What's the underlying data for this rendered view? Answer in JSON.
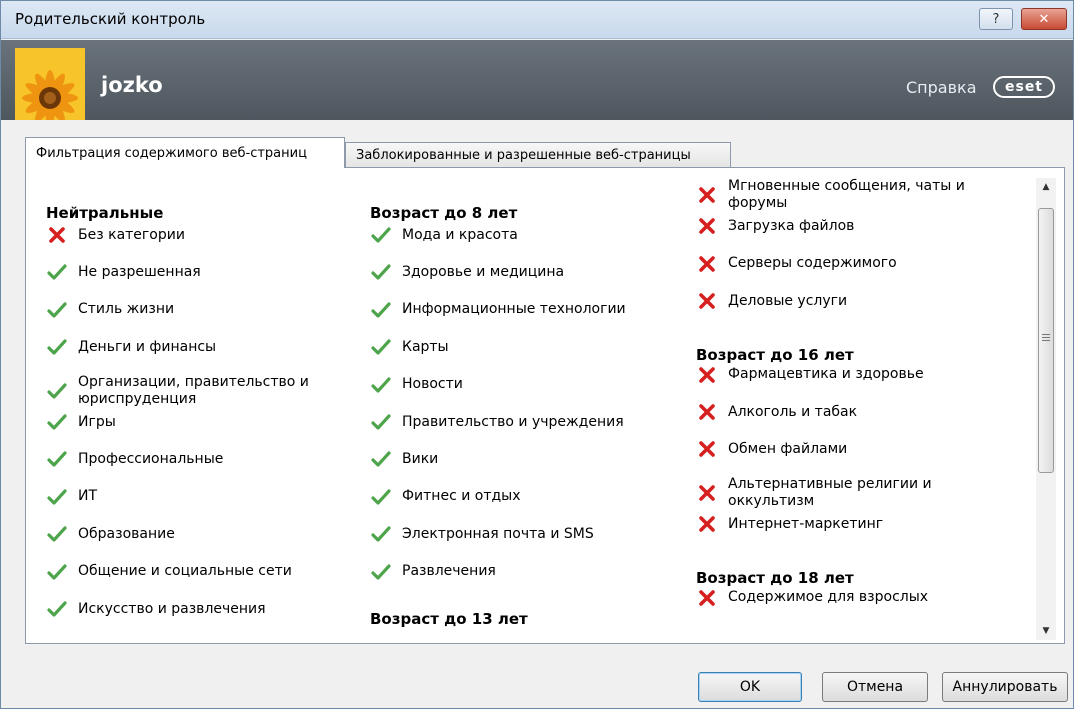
{
  "window": {
    "title": "Родительский контроль",
    "help_glyph": "?",
    "close_glyph": "✕"
  },
  "header": {
    "user_name": "jozko",
    "help_link": "Справка",
    "logo_text": "eset"
  },
  "tabs": [
    {
      "label": "Фильтрация содержимого веб-страниц"
    },
    {
      "label": "Заблокированные и разрешенные веб-страницы"
    }
  ],
  "icons": {
    "allowed": "check-icon",
    "blocked": "x-icon",
    "allowed_color": "#4ea44a",
    "blocked_color": "#d62020"
  },
  "columns": [
    {
      "groups": [
        {
          "heading": "Нейтральные",
          "items": [
            {
              "label": "Без категории",
              "state": "blocked"
            },
            {
              "label": "Не разрешенная",
              "state": "allowed"
            },
            {
              "label": "Стиль жизни",
              "state": "allowed"
            },
            {
              "label": "Деньги и финансы",
              "state": "allowed"
            },
            {
              "label": "Организации, правительство и юриспруденция",
              "state": "allowed"
            },
            {
              "label": "Игры",
              "state": "allowed"
            },
            {
              "label": "Профессиональные",
              "state": "allowed"
            },
            {
              "label": "ИТ",
              "state": "allowed"
            },
            {
              "label": "Образование",
              "state": "allowed"
            },
            {
              "label": "Общение и социальные сети",
              "state": "allowed"
            },
            {
              "label": "Искусство и развлечения",
              "state": "allowed"
            }
          ]
        }
      ]
    },
    {
      "groups": [
        {
          "heading": "Возраст до 8 лет",
          "items": [
            {
              "label": "Мода и красота",
              "state": "allowed"
            },
            {
              "label": "Здоровье и медицина",
              "state": "allowed"
            },
            {
              "label": "Информационные технологии",
              "state": "allowed"
            },
            {
              "label": "Карты",
              "state": "allowed"
            },
            {
              "label": "Новости",
              "state": "allowed"
            },
            {
              "label": "Правительство и учреждения",
              "state": "allowed"
            },
            {
              "label": "Вики",
              "state": "allowed"
            },
            {
              "label": "Фитнес и отдых",
              "state": "allowed"
            },
            {
              "label": "Электронная почта и SMS",
              "state": "allowed"
            },
            {
              "label": "Развлечения",
              "state": "allowed"
            }
          ]
        },
        {
          "heading": "Возраст до 13 лет",
          "items": []
        }
      ]
    },
    {
      "groups": [
        {
          "heading": "",
          "items": [
            {
              "label": "Мгновенные сообщения, чаты и форумы",
              "state": "blocked"
            },
            {
              "label": "Загрузка файлов",
              "state": "blocked"
            },
            {
              "label": "Серверы содержимого",
              "state": "blocked"
            },
            {
              "label": "Деловые услуги",
              "state": "blocked"
            }
          ]
        },
        {
          "heading": "Возраст до 16 лет",
          "items": [
            {
              "label": "Фармацевтика и здоровье",
              "state": "blocked"
            },
            {
              "label": "Алкоголь и табак",
              "state": "blocked"
            },
            {
              "label": "Обмен файлами",
              "state": "blocked"
            },
            {
              "label": "Альтернативные религии и оккультизм",
              "state": "blocked"
            },
            {
              "label": "Интернет-маркетинг",
              "state": "blocked"
            }
          ]
        },
        {
          "heading": "Возраст до 18 лет",
          "items": [
            {
              "label": "Содержимое для взрослых",
              "state": "blocked"
            }
          ]
        }
      ]
    }
  ],
  "buttons": {
    "ok": "OK",
    "cancel": "Отмена",
    "reset": "Аннулировать"
  }
}
